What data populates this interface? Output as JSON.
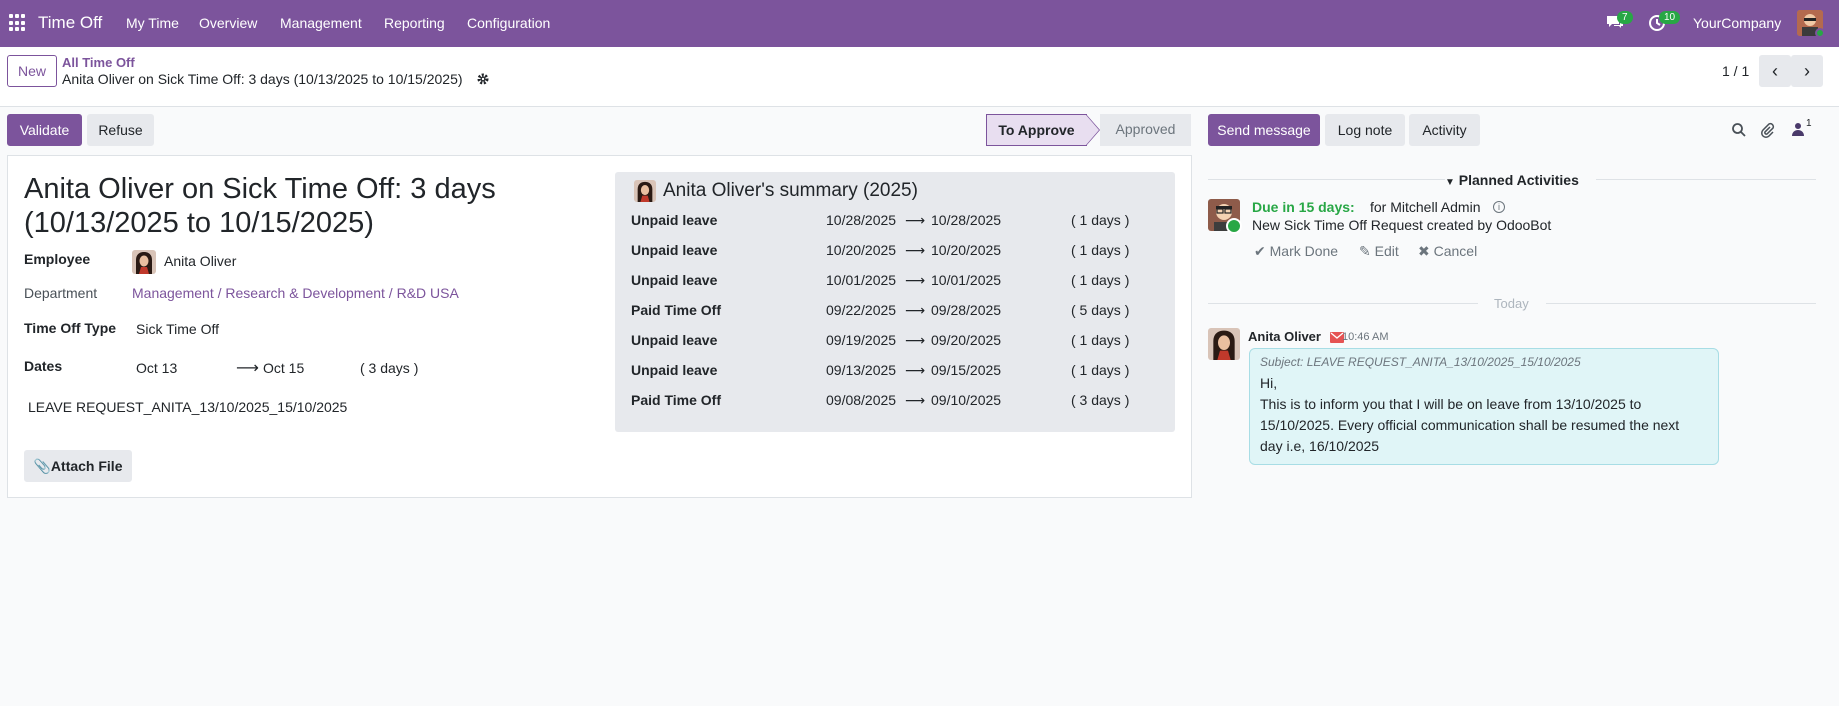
{
  "navbar": {
    "brand": "Time Off",
    "menu": [
      "My Time",
      "Overview",
      "Management",
      "Reporting",
      "Configuration"
    ],
    "messages_count": "7",
    "activities_count": "10",
    "company": "YourCompany",
    "bg_color": "#7c549c"
  },
  "control_panel": {
    "new_label": "New",
    "breadcrumb_parent": "All Time Off",
    "breadcrumb_current": "Anita Oliver on Sick Time Off: 3 days (10/13/2025 to 10/15/2025)",
    "pager": "1 / 1"
  },
  "actions": {
    "validate": "Validate",
    "refuse": "Refuse"
  },
  "status": {
    "stages": [
      "To Approve",
      "Approved"
    ],
    "current": "To Approve"
  },
  "form": {
    "title": "Anita Oliver on Sick Time Off: 3 days (10/13/2025 to 10/15/2025)",
    "employee_label": "Employee",
    "employee": "Anita Oliver",
    "department_label": "Department",
    "department": "Management / Research & Development / R&D USA",
    "type_label": "Time Off Type",
    "type": "Sick Time Off",
    "dates_label": "Dates",
    "date_from": "Oct 13",
    "date_to": "Oct 15",
    "duration": "( 3 days )",
    "description": "LEAVE REQUEST_ANITA_13/10/2025_15/10/2025",
    "attach_label": "Attach File"
  },
  "summary": {
    "title": "Anita Oliver's summary (2025)",
    "rows": [
      {
        "type": "Unpaid leave",
        "from": "10/28/2025",
        "to": "10/28/2025",
        "days": "( 1 days )"
      },
      {
        "type": "Unpaid leave",
        "from": "10/20/2025",
        "to": "10/20/2025",
        "days": "( 1 days )"
      },
      {
        "type": "Unpaid leave",
        "from": "10/01/2025",
        "to": "10/01/2025",
        "days": "( 1 days )"
      },
      {
        "type": "Paid Time Off",
        "from": "09/22/2025",
        "to": "09/28/2025",
        "days": "( 5 days )"
      },
      {
        "type": "Unpaid leave",
        "from": "09/19/2025",
        "to": "09/20/2025",
        "days": "( 1 days )"
      },
      {
        "type": "Unpaid leave",
        "from": "09/13/2025",
        "to": "09/15/2025",
        "days": "( 1 days )"
      },
      {
        "type": "Paid Time Off",
        "from": "09/08/2025",
        "to": "09/10/2025",
        "days": "( 3 days )"
      }
    ]
  },
  "chatter": {
    "send_message": "Send message",
    "log_note": "Log note",
    "activity": "Activity",
    "followers_count": "1",
    "planned_title": "Planned Activities",
    "due": "Due in 15 days:",
    "for_user": "for Mitchell Admin",
    "activity_summary": "New Sick Time Off Request created by OdooBot",
    "mark_done": "Mark Done",
    "edit": "Edit",
    "cancel": "Cancel",
    "today": "Today",
    "msg_author": "Anita Oliver",
    "msg_time": "10:46 AM",
    "msg_subject": "Subject: LEAVE REQUEST_ANITA_13/10/2025_15/10/2025",
    "msg_line1": "Hi,",
    "msg_line2": "This is to inform you that I will be on leave from 13/10/2025 to",
    "msg_line3": "15/10/2025. Every official communication shall be resumed the next",
    "msg_line4": "day i.e, 16/10/2025"
  }
}
